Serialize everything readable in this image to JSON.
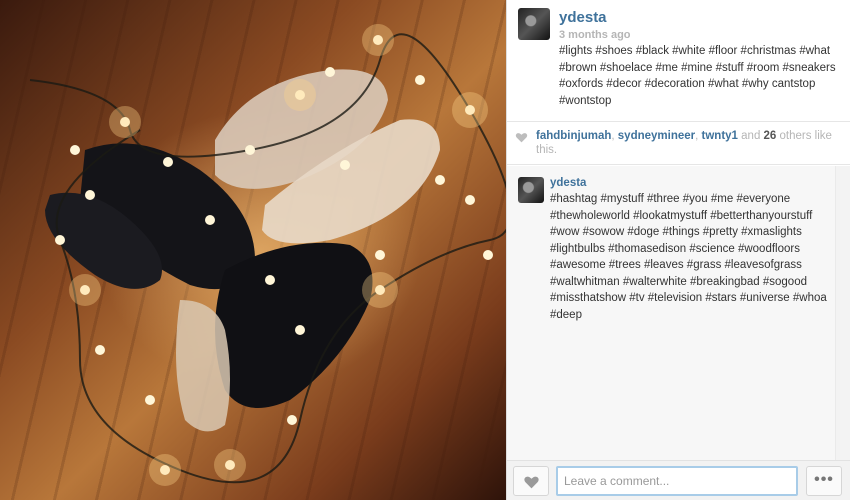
{
  "post": {
    "username": "ydesta",
    "time_ago": "3 months ago",
    "caption": "#lights #shoes #black #white #floor #christmas #what #brown #shoelace #me #mine #stuff #room #sneakers #oxfords #decor #decoration #what #why cantstop #wontstop"
  },
  "likes": {
    "users": [
      "fahdbinjumah",
      "sydneymineer",
      "twnty1"
    ],
    "separator_1": ", ",
    "separator_2": ", ",
    "and_text": " and ",
    "others_count": "26",
    "others_text": " others like this."
  },
  "comments": [
    {
      "username": "ydesta",
      "text": "#hashtag #mystuff #three #you #me #everyone #thewholeworld #lookatmystuff #betterthanyourstuff #wow #sowow #doge #things #pretty #xmaslights #lightbulbs #thomasedison #science #woodfloors #awesome #trees #leaves #grass #leavesofgrass #waltwhitman #walterwhite #breakingbad #sogood #missthatshow #tv #television #stars #universe #whoa #deep"
    }
  ],
  "comment_box": {
    "placeholder": "Leave a comment...",
    "more_label": "•••"
  },
  "icons": {
    "like": "heart-icon",
    "likes_indicator": "heart-icon",
    "more": "ellipsis-icon"
  },
  "colors": {
    "link": "#3f729b",
    "muted": "#b5b5b5",
    "input_focus": "#a8cce8"
  }
}
